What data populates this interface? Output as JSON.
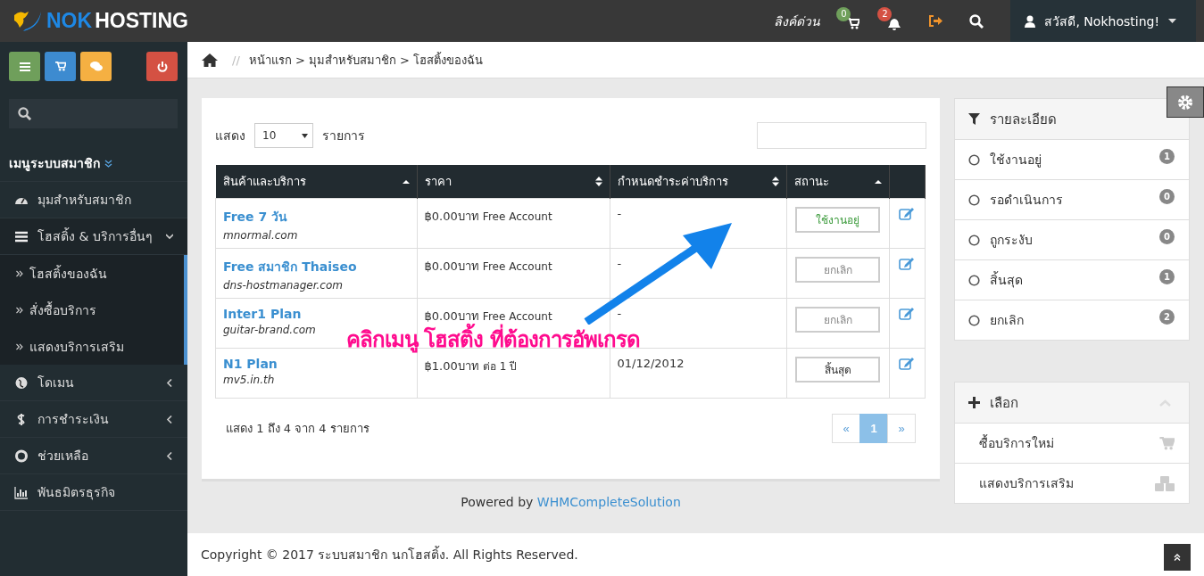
{
  "logo": {
    "part1": "NOK",
    "part2": "HOSTING"
  },
  "topbar": {
    "quick_links": "ลิงค์ด่วน",
    "cart_badge": "0",
    "bell_badge": "2",
    "user": "สวัสดี, Nokhosting!"
  },
  "sidebar": {
    "heading": "เมนูระบบสมาชิก",
    "items": [
      {
        "label": "มุมสำหรับสมาชิก",
        "has_chevron": false
      },
      {
        "label": "โฮสติ้ง & บริการอื่นๆ",
        "expanded": true,
        "has_chevron": true,
        "children": [
          {
            "label": "โฮสติ้งของฉัน"
          },
          {
            "label": "สั่งซื้อบริการ"
          },
          {
            "label": "แสดงบริการเสริม"
          }
        ]
      },
      {
        "label": "โดเมน",
        "expanded": false,
        "has_chevron": true
      },
      {
        "label": "การชำระเงิน",
        "expanded": false,
        "has_chevron": true
      },
      {
        "label": "ช่วยเหลือ",
        "expanded": false,
        "has_chevron": true
      },
      {
        "label": "พันธมิตรธุรกิจ",
        "has_chevron": false
      }
    ]
  },
  "breadcrumb": {
    "separator": "//",
    "path": "หน้าแรก > มุมสำหรับสมาชิก > โฮสติ้งของฉัน"
  },
  "table_controls": {
    "show_label": "แสดง",
    "page_size": "10",
    "entries_label": "รายการ"
  },
  "table": {
    "columns": [
      {
        "label": "สินค้าและบริการ",
        "sorted": true
      },
      {
        "label": "ราคา",
        "sorted": false
      },
      {
        "label": "กำหนดชำระค่าบริการ",
        "sorted": false
      },
      {
        "label": "สถานะ",
        "sorted": true
      }
    ],
    "rows": [
      {
        "product": "Free 7 วัน",
        "domain": "mnormal.com",
        "price": "฿0.00บาท",
        "cycle": "Free Account",
        "due": "-",
        "status": "ใช้งานอยู่",
        "color": "#3a9a3a"
      },
      {
        "product": "Free สมาชิก Thaiseo",
        "domain": "dns-hostmanager.com",
        "price": "฿0.00บาท",
        "cycle": "Free Account",
        "due": "-",
        "status": "ยกเลิก",
        "color": "#888888"
      },
      {
        "product": "Inter1 Plan",
        "domain": "guitar-brand.com",
        "price": "฿0.00บาท",
        "cycle": "Free Account",
        "due": "-",
        "status": "ยกเลิก",
        "color": "#888888"
      },
      {
        "product": "N1 Plan",
        "domain": "mv5.in.th",
        "price": "฿1.00บาท",
        "cycle": "ต่อ 1 ปี",
        "due": "01/12/2012",
        "status": "สิ้นสุด",
        "color": "#333333"
      }
    ]
  },
  "table_info": "แสดง 1 ถึง 4 จาก 4 รายการ",
  "pagination": [
    {
      "label": "«",
      "selected": false
    },
    {
      "label": "1",
      "selected": true
    },
    {
      "label": "»",
      "selected": false
    }
  ],
  "annotation": {
    "text": "คลิกเมนู โฮสติ้ง ที่ต้องการอัพเกรด"
  },
  "details_panel": {
    "title": "รายละเอียด",
    "items": [
      {
        "label": "ใช้งานอยู่",
        "count": "1"
      },
      {
        "label": "รอดำเนินการ",
        "count": "0"
      },
      {
        "label": "ถูกระงับ",
        "count": "0"
      },
      {
        "label": "สิ้นสุด",
        "count": "1"
      },
      {
        "label": "ยกเลิก",
        "count": "2"
      }
    ]
  },
  "actions_panel": {
    "title": "เลือก",
    "items": [
      {
        "label": "ซื้อบริการใหม่"
      },
      {
        "label": "แสดงบริการเสริม"
      }
    ]
  },
  "powered_by": {
    "text": "Powered by",
    "link": "WHMCompleteSolution"
  },
  "footer": "Copyright © 2017 ระบบสมาชิก นกโฮสติ้ง. All Rights Reserved."
}
